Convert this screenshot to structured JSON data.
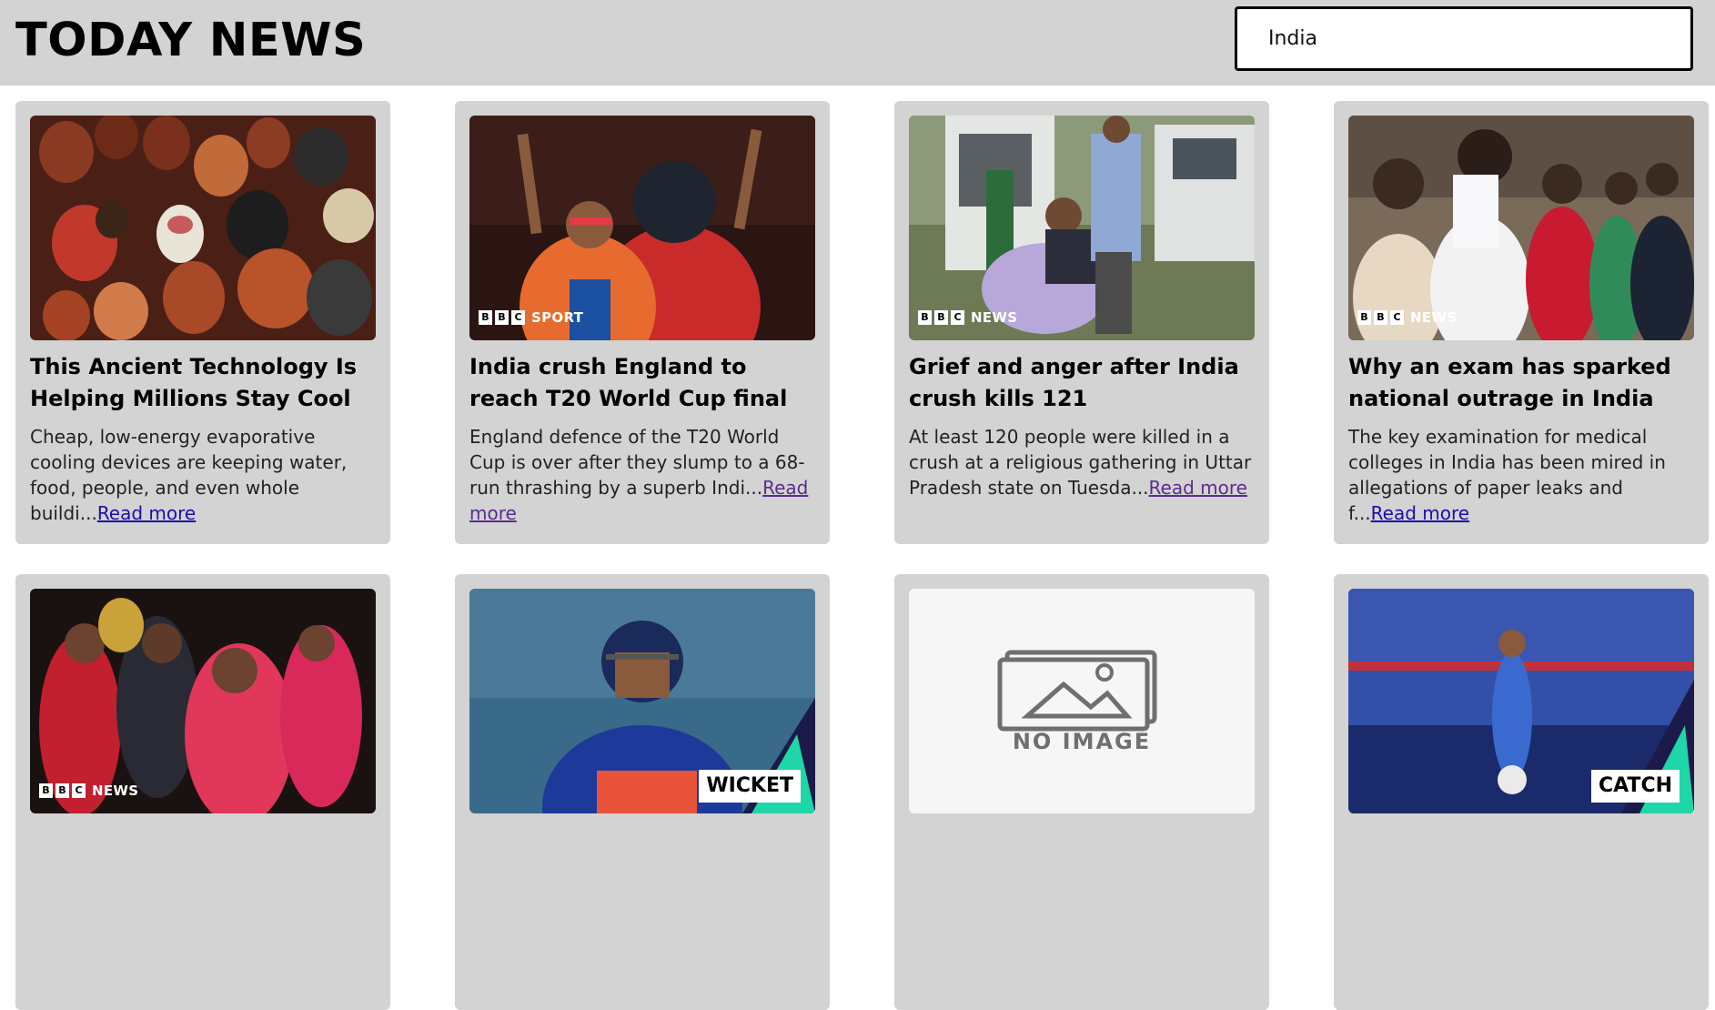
{
  "header": {
    "title": "TODAY NEWS",
    "search_value": "India"
  },
  "articles": [
    {
      "title": "This Ancient Technology Is Helping Millions Stay Cool",
      "description": "Cheap, low-energy evaporative cooling devices are keeping water, food, people, and even whole buildi...",
      "read_more": "Read more",
      "image": "clay-pots-photo",
      "badge": ""
    },
    {
      "title": "India crush England to reach T20 World Cup final",
      "description": "England defence of the T20 World Cup is over after they slump to a 68-run thrashing by a superb Indi...",
      "read_more": "Read more",
      "image": "cricket-celebration-photo",
      "badge": "SPORT"
    },
    {
      "title": "Grief and anger after India crush kills 121",
      "description": "At least 120 people were killed in a crush at a religious gathering in Uttar Pradesh state on Tuesda...",
      "read_more": "Read more",
      "image": "ambulance-grief-photo",
      "badge": "NEWS"
    },
    {
      "title": "Why an exam has sparked national outrage in India",
      "description": "The key examination for medical colleges in India has been mired in allegations of paper leaks and f...",
      "read_more": "Read more",
      "image": "students-queue-photo",
      "badge": "NEWS"
    },
    {
      "title": "",
      "description": "",
      "read_more": "",
      "image": "women-crowd-photo",
      "badge": "NEWS"
    },
    {
      "title": "",
      "description": "",
      "read_more": "",
      "image": "cricket-batsman-photo",
      "overlay": "WICKET"
    },
    {
      "title": "",
      "description": "",
      "read_more": "",
      "image": "no-image-placeholder",
      "placeholder_text": "NO IMAGE"
    },
    {
      "title": "",
      "description": "",
      "read_more": "",
      "image": "cricket-catch-photo",
      "overlay": "CATCH"
    }
  ],
  "brand": {
    "bbc_letters": [
      "B",
      "B",
      "C"
    ]
  },
  "colors": {
    "header_bg": "#d3d3d3",
    "card_bg": "#d3d3d3",
    "link": "#1a0dab",
    "link_visited": "#5b2c8f"
  }
}
